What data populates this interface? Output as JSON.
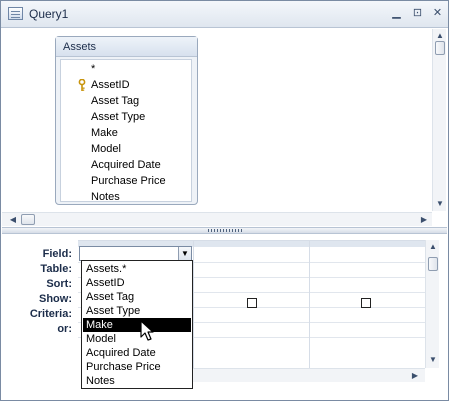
{
  "window": {
    "title": "Query1",
    "controls": [
      "minimize",
      "restore",
      "close"
    ]
  },
  "table": {
    "name": "Assets",
    "fields": [
      {
        "label": "*",
        "key": false
      },
      {
        "label": "AssetID",
        "key": true
      },
      {
        "label": "Asset Tag",
        "key": false
      },
      {
        "label": "Asset Type",
        "key": false
      },
      {
        "label": "Make",
        "key": false
      },
      {
        "label": "Model",
        "key": false
      },
      {
        "label": "Acquired Date",
        "key": false
      },
      {
        "label": "Purchase Price",
        "key": false
      },
      {
        "label": "Notes",
        "key": false
      }
    ]
  },
  "grid": {
    "row_labels": [
      "Field:",
      "Table:",
      "Sort:",
      "Show:",
      "Criteria:",
      "or:"
    ],
    "field_value": ""
  },
  "dropdown": {
    "options": [
      "Assets.*",
      "AssetID",
      "Asset Tag",
      "Asset Type",
      "Make",
      "Model",
      "Acquired Date",
      "Purchase Price",
      "Notes"
    ],
    "selected": "Make"
  },
  "icons": {
    "key": "primary-key-icon",
    "dropdown": "chevron-down-icon"
  },
  "colors": {
    "frame": "#7a8ba3",
    "selection_bg": "#000000",
    "selection_text": "#ffffff"
  }
}
